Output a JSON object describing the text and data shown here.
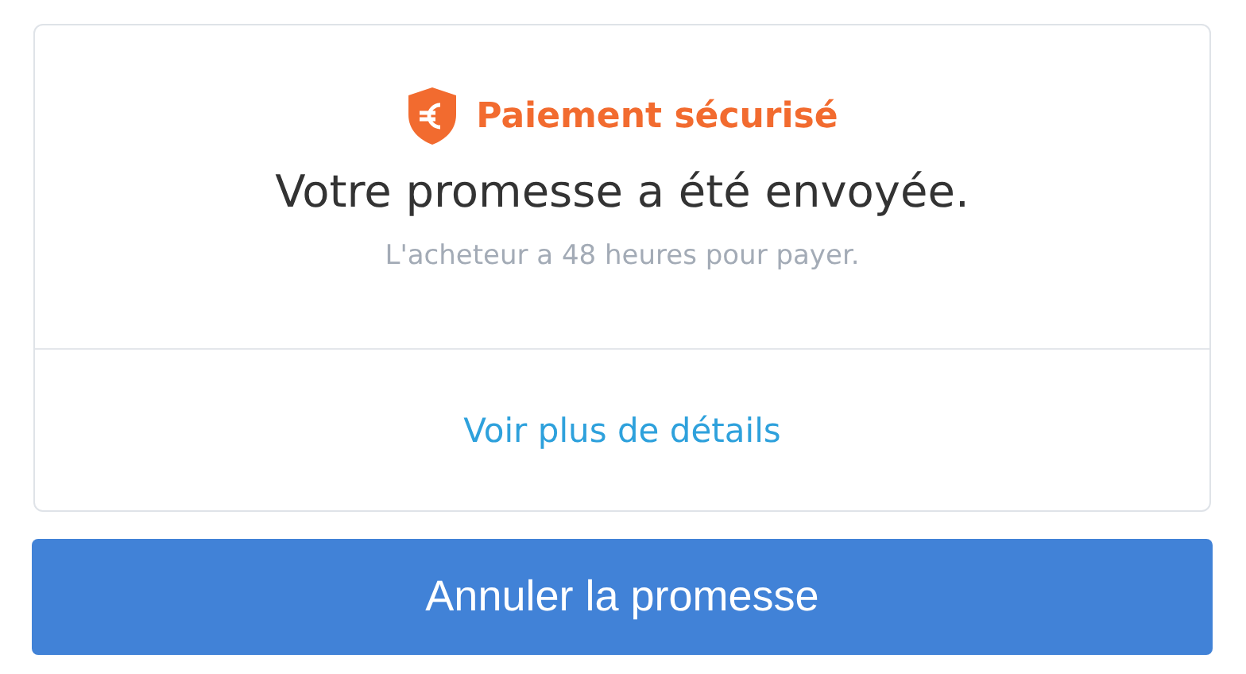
{
  "card": {
    "badge": "Paiement sécurisé",
    "title": "Votre promesse a été envoyée.",
    "subtitle": "L'acheteur a 48 heures pour payer.",
    "link": "Voir plus de détails"
  },
  "button": {
    "label": "Annuler la promesse"
  }
}
